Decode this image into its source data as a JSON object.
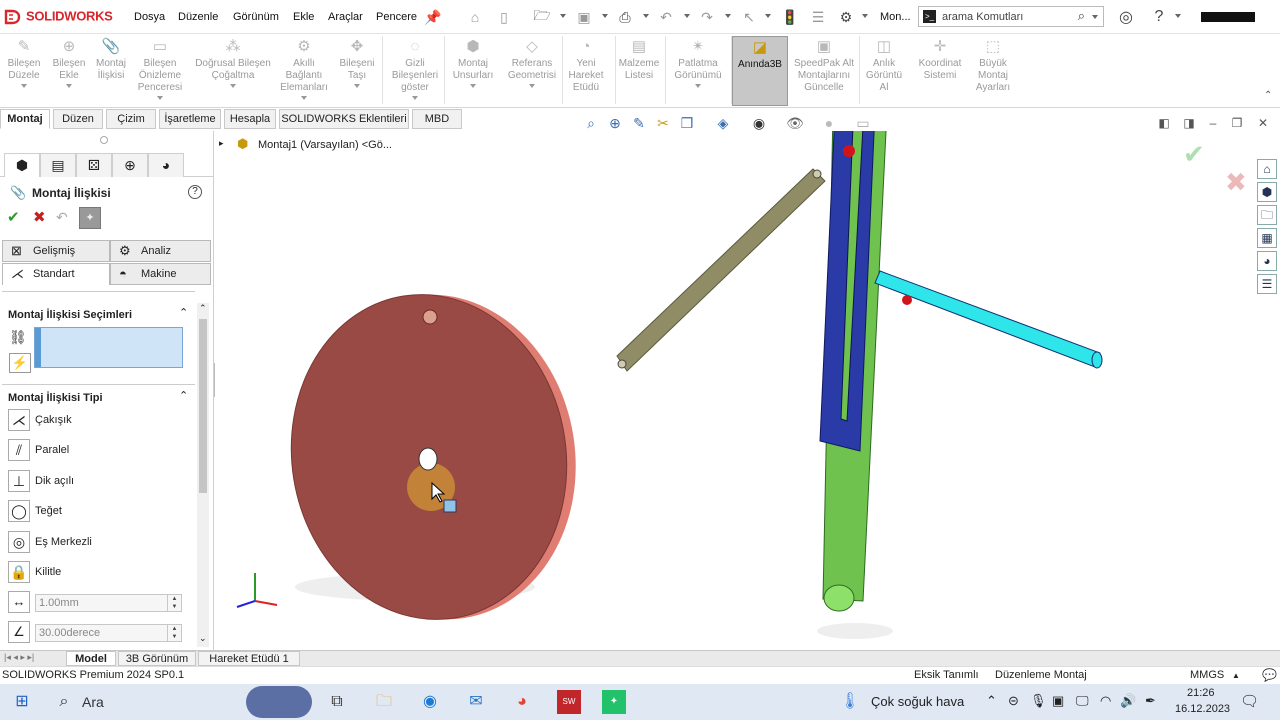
{
  "app": {
    "brand": "SOLIDWORKS"
  },
  "menu": [
    "Dosya",
    "Düzenle",
    "Görünüm",
    "Ekle",
    "Araçlar",
    "Pencere"
  ],
  "title_short": "Mon...",
  "search": {
    "placeholder": "arama Komutları"
  },
  "ribbon": [
    {
      "label": "Bileşen Düzele",
      "icon": "edit-component-icon"
    },
    {
      "label": "Bileşen Ekle",
      "icon": "insert-component-icon"
    },
    {
      "label": "Montaj İlişkisi",
      "icon": "mate-icon"
    },
    {
      "label": "Bileşen Önizleme Penceresi",
      "icon": "preview-icon"
    },
    {
      "label": "Doğrusal Bileşen Çoğaltma",
      "icon": "linear-pattern-icon"
    },
    {
      "label": "Akıllı Bağlantı Elemanları",
      "icon": "smart-fasteners-icon"
    },
    {
      "label": "Bileşeni Taşı",
      "icon": "move-component-icon"
    },
    {
      "label": "Gizli Bileşenleri göster",
      "icon": "show-hidden-icon"
    },
    {
      "label": "Montaj Unsurları",
      "icon": "assembly-features-icon"
    },
    {
      "label": "Referans Geometrisi",
      "icon": "reference-geometry-icon"
    },
    {
      "label": "Yeni Hareket Etüdü",
      "icon": "motion-study-icon"
    },
    {
      "label": "Malzeme Listesi",
      "icon": "bom-icon"
    },
    {
      "label": "Patlatma Görünümü",
      "icon": "exploded-view-icon"
    },
    {
      "label": "Anında3B",
      "icon": "instant3d-icon"
    },
    {
      "label": "SpeedPak Alt Montajlarını Güncelle",
      "icon": "speedpak-icon"
    },
    {
      "label": "Anlık Görüntü Al",
      "icon": "snapshot-icon"
    },
    {
      "label": "Koordinat Sistemi",
      "icon": "coordinate-system-icon"
    },
    {
      "label": "Büyük Montaj Ayarları",
      "icon": "large-assembly-icon"
    }
  ],
  "tabs": [
    "Montaj",
    "Düzen",
    "Çizim",
    "İşaretleme",
    "Hesapla",
    "SOLIDWORKS Eklentileri",
    "MBD"
  ],
  "tree_root": "Montaj1 (Varsayılan) <Gö...",
  "pm": {
    "title": "Montaj İlişkisi",
    "subtabs": [
      "Gelişmiş",
      "Analiz",
      "Standart",
      "Makine"
    ],
    "selections_header": "Montaj İlişkisi Seçimleri",
    "type_header": "Montaj İlişkisi Tipi",
    "types": [
      "Çakışık",
      "Paralel",
      "Dik açılı",
      "Teğet",
      "Eş Merkezli",
      "Kilitle"
    ],
    "distance": "1.00mm",
    "angle": "30.00derece"
  },
  "bottom_tabs": [
    "Model",
    "3B Görünüm",
    "Hareket Etüdü 1"
  ],
  "status": {
    "product": "SOLIDWORKS Premium 2024 SP0.1",
    "state1": "Eksik Tanımlı",
    "state2": "Düzenleme Montaj",
    "units": "MMGS"
  },
  "taskbar": {
    "search": "Ara",
    "weather": "Çok soğuk hava",
    "time": "21:26",
    "date": "16.12.2023"
  },
  "colors": {
    "disk": "#9a4a44",
    "slider_blue": "#2a3aa6",
    "arm_green": "#6fc24e",
    "rod_cyan": "#2ee6ea",
    "link_olive": "#8f8c66",
    "pin_red": "#d2141a"
  }
}
